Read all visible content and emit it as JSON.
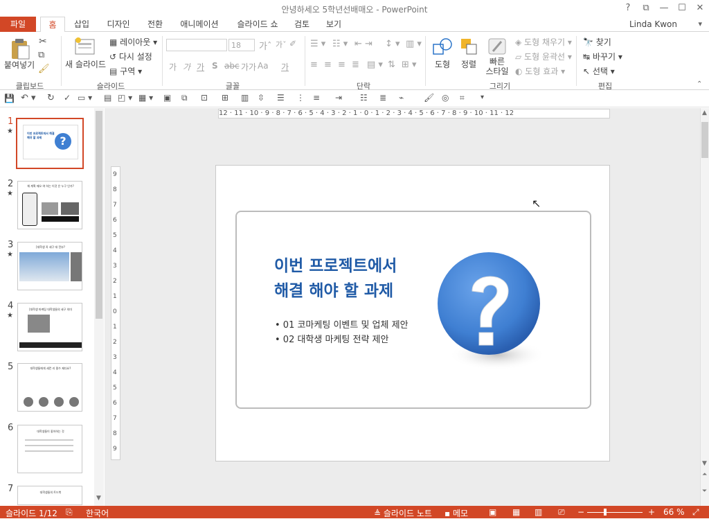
{
  "window": {
    "title": "안녕하세오 5학년선배매오 - PowerPoint",
    "controls": [
      "?",
      "⧉",
      "—",
      "☐",
      "✕"
    ]
  },
  "tabs": [
    {
      "label": "파일"
    },
    {
      "label": "홈"
    },
    {
      "label": "삽입"
    },
    {
      "label": "디자인"
    },
    {
      "label": "전환"
    },
    {
      "label": "애니메이션"
    },
    {
      "label": "슬라이드 쇼"
    },
    {
      "label": "검토"
    },
    {
      "label": "보기"
    }
  ],
  "user": "Linda Kwon",
  "ribbon": {
    "clipboard": {
      "paste": "붙여넣기",
      "group": "클립보드"
    },
    "slides": {
      "new_slide": "새 슬라이드",
      "layout": "레이아웃",
      "reset": "다시 설정",
      "section": "구역",
      "group": "슬라이드"
    },
    "font": {
      "font_size": "18",
      "group": "글꼴",
      "spacing": "가가",
      "case": "Aa"
    },
    "paragraph": {
      "group": "단락"
    },
    "drawing": {
      "shapes": "도형",
      "arrange": "정렬",
      "quick_styles": "빠른 스타일",
      "fill": "도형 채우기",
      "outline": "도형 윤곽선",
      "effects": "도형 효과",
      "group": "그리기"
    },
    "editing": {
      "find": "찾기",
      "replace": "바꾸기",
      "select": "선택",
      "group": "편집"
    }
  },
  "thumbnails": [
    {
      "num": "1",
      "star": "★",
      "title": "이번 프로젝트에서 해결 해야 할 과제"
    },
    {
      "num": "2",
      "star": "★",
      "title": "체 계획 매오 여 하는 이것 은 누구 인가?"
    },
    {
      "num": "3",
      "star": "★",
      "title": "[대학생 꼭 세구 대 전부?"
    },
    {
      "num": "4",
      "star": "★",
      "title": "[대학생 마케팅 대학생들의 세구 의미"
    },
    {
      "num": "5",
      "star": "",
      "title": "대학생들에게 세컨 리 필수 제다요?"
    },
    {
      "num": "6",
      "star": "",
      "title": "대학생들이 좋아하는 것"
    },
    {
      "num": "7",
      "star": "",
      "title": "대학생들의 트드북"
    }
  ],
  "ruler": {
    "horizontal": "12 · 11 · 10 · 9 · 8 · 7 · 6 · 5 · 4 · 3 · 2 · 1 · 0 · 1 · 2 · 3 · 4 · 5 · 6 · 7 · 8 · 9 · 10 · 11 · 12",
    "vertical": [
      "9",
      "8",
      "7",
      "6",
      "5",
      "4",
      "3",
      "2",
      "1",
      "0",
      "1",
      "2",
      "3",
      "4",
      "5",
      "6",
      "7",
      "8",
      "9"
    ]
  },
  "slide": {
    "title_line1": "이번 프로젝트에서",
    "title_line2": "해결 해야 할 과제",
    "bullets": [
      "• 01 코마케팅 이벤트 및 업체 제안",
      "• 02 대학생 마케팅 전략 제안"
    ]
  },
  "status": {
    "slide_counter": "슬라이드 1/12",
    "language": "한국어",
    "notes": "슬라이드 노트",
    "comments": "메모",
    "zoom": "66 %"
  },
  "colors": {
    "accent": "#d24726",
    "title_blue": "#1f5aa6",
    "icon_blue": "#3f7fd2"
  }
}
